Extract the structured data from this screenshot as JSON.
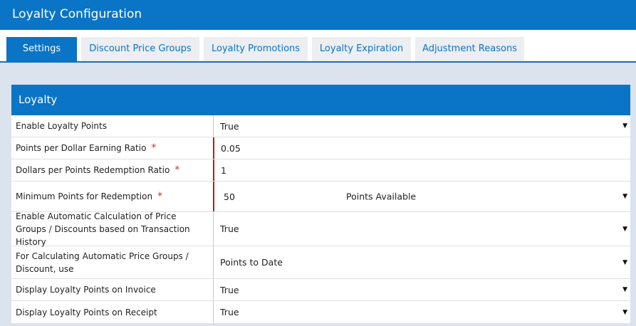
{
  "app": {
    "title": "Loyalty Configuration"
  },
  "tabs": [
    {
      "label": "Settings",
      "active": true
    },
    {
      "label": "Discount Price Groups"
    },
    {
      "label": "Loyalty Promotions"
    },
    {
      "label": "Loyalty Expiration"
    },
    {
      "label": "Adjustment Reasons"
    }
  ],
  "panel": {
    "title": "Loyalty",
    "rows": [
      {
        "label": "Enable Loyalty Points",
        "value": "True",
        "type": "select"
      },
      {
        "label": "Points per Dollar Earning Ratio",
        "value": "0.05",
        "required": true,
        "type": "input"
      },
      {
        "label": "Dollars per Points Redemption Ratio",
        "value": "1",
        "required": true,
        "type": "input"
      },
      {
        "label": "Minimum Points for Redemption",
        "value": "50",
        "secondary_value": "Points Available",
        "required": true,
        "type": "select"
      },
      {
        "label": "Enable Automatic Calculation of Price Groups / Discounts based on Transaction History",
        "value": "True",
        "type": "select"
      },
      {
        "label": "For Calculating Automatic Price Groups / Discount, use",
        "value": "Points to Date",
        "type": "select"
      },
      {
        "label": "Display Loyalty Points on Invoice",
        "value": "True",
        "type": "select"
      },
      {
        "label": "Display Loyalty Points on Receipt",
        "value": "True",
        "type": "select"
      }
    ]
  },
  "icons": {
    "dropdown": "caret-down-icon",
    "required_marker": "*"
  },
  "colors": {
    "brand": "#0a74c6",
    "required": "#b0201e",
    "background": "#dbe3ee",
    "tab_inactive": "#eceef1"
  }
}
